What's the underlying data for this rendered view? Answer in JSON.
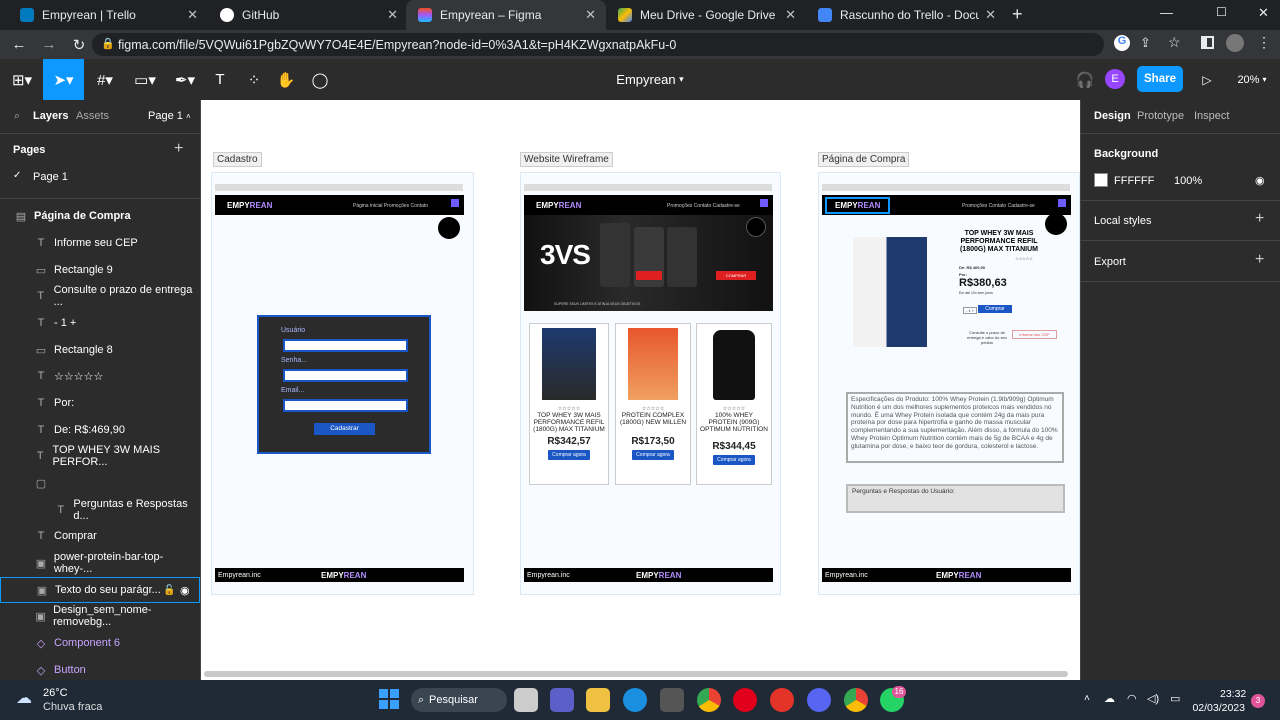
{
  "browser": {
    "tabs": [
      {
        "title": "Empyrean | Trello",
        "color": "#0079bf"
      },
      {
        "title": "GitHub",
        "color": "#ffffff"
      },
      {
        "title": "Empyrean – Figma",
        "color": "#f24e1e"
      },
      {
        "title": "Meu Drive - Google Drive",
        "color": "#34a853"
      },
      {
        "title": "Rascunho do Trello - Documento",
        "color": "#4285f4"
      }
    ],
    "url": "figma.com/file/5VQWui61PgbZQvWY7O4E4E/Empyrean?node-id=0%3A1&t=pH4KZWgxnatpAkFu-0"
  },
  "figma": {
    "file_name": "Empyrean",
    "share_label": "Share",
    "zoom": "20%",
    "avatar_letter": "E"
  },
  "left_panel": {
    "tab_layers": "Layers",
    "tab_assets": "Assets",
    "page_selector": "Page 1",
    "pages_heading": "Pages",
    "current_page": "Page 1",
    "layers": [
      {
        "name": "Página de Compra",
        "icon": "frame-icon"
      },
      {
        "name": "Informe seu CEP",
        "icon": "text-icon"
      },
      {
        "name": "Rectangle 9",
        "icon": "rect-icon"
      },
      {
        "name": "Consulte o prazo de entrega ...",
        "icon": "text-icon"
      },
      {
        "name": "- 1 +",
        "icon": "text-icon"
      },
      {
        "name": "Rectangle 8",
        "icon": "rect-icon"
      },
      {
        "name": "☆☆☆☆☆",
        "icon": "text-icon"
      },
      {
        "name": "Por:",
        "icon": "text-icon"
      },
      {
        "name": "De: R$:469,90",
        "icon": "text-icon"
      },
      {
        "name": "TOP WHEY 3W MAIS PERFOR...",
        "icon": "text-icon"
      },
      {
        "name": "",
        "icon": "group-icon"
      },
      {
        "name": "Perguntas e Respostas d...",
        "icon": "text-icon"
      },
      {
        "name": "Comprar",
        "icon": "text-icon"
      },
      {
        "name": "power-protein-bar-top-whey-...",
        "icon": "image-icon"
      },
      {
        "name": "Texto do seu parágr...",
        "icon": "image-icon"
      },
      {
        "name": "Design_sem_nome-removebg...",
        "icon": "image-icon"
      },
      {
        "name": "Component 6",
        "icon": "component-icon"
      },
      {
        "name": "Button",
        "icon": "component-icon"
      }
    ]
  },
  "right_panel": {
    "tabs": [
      "Design",
      "Prototype",
      "Inspect"
    ],
    "background_label": "Background",
    "background_hex": "FFFFFF",
    "background_opacity": "100%",
    "local_styles": "Local styles",
    "export": "Export"
  },
  "canvas": {
    "frames": [
      "Cadastro",
      "Website Wireframe",
      "Página de Compra"
    ],
    "logo_main": "EMPY",
    "logo_accent": "REAN",
    "nav_links_1": "Página inicial   Promoções   Contato",
    "nav_links_2": "Promoções   Contato   Cadastre-se",
    "footer_text": "Empyrean.inc",
    "form": {
      "user_label": "Usuário",
      "password_label": "Senha...",
      "email_label": "Email...",
      "submit": "Cadastrar"
    },
    "hero_brand": "3VS",
    "hero_button": "COMPRAR",
    "hero_tagline": "SUPERE SEUS LIMITES E ATINJA SEUS OBJETIVOS",
    "products": [
      {
        "name": "TOP WHEY 3W MAIS PERFORMANCE REFIL (1800G) MAX TITANIUM",
        "price": "R$342,57",
        "stars": "☆☆☆☆☆",
        "button": "Comprar agora"
      },
      {
        "name": "PROTEIN COMPLEX (1800G) NEW MILLEN",
        "price": "R$173,50",
        "stars": "☆☆☆☆☆",
        "button": "Comprar agora"
      },
      {
        "name": "100% WHEY PROTEIN (909G) OPTIMUM NUTRITION",
        "price": "R$344,45",
        "stars": "☆☆☆☆☆",
        "button": "Comprar agora"
      }
    ],
    "purchase": {
      "title": "TOP WHEY 3W MAIS PERFORMANCE REFIL (1800G) MAX TITANIUM",
      "stars": "☆☆☆☆☆",
      "old_price": "De: R$ 469,90",
      "por": "Por:",
      "price": "R$380,63",
      "installments": "Em até 10x sem juros",
      "qty": "- 1 +",
      "buy": "Comprar",
      "shipping": "Consulte o prazo de entrega e valor do seu pedido",
      "cep": "Informe seu CEP",
      "description": "Especificações do Produto: 100% Whey Protein (1.9lb/909g) Optimum Nutrition é um dos melhores suplementos proteicos mais vendidos no mundo. É uma Whey Protein isolada que contém 24g da mais pura proteína por dose para hipertrofia e ganho de massa muscular complementando a sua suplementação. Além disso, a fórmula do 100% Whey Protein Optimum Nutrition contém mais de 5g de BCAA e 4g de glutamina por dose, e baixo teor de gordura, colesterol e lactose.",
      "qa": "Perguntas e Respostas do Usuário:"
    }
  },
  "taskbar": {
    "temp": "26°C",
    "weather": "Chuva fraca",
    "search": "Pesquisar",
    "time": "23:32",
    "date": "02/03/2023",
    "badge": "16",
    "notif": "3"
  }
}
